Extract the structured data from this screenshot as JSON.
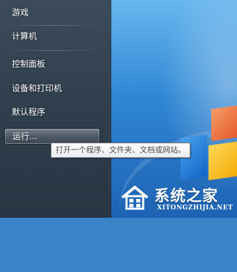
{
  "start_menu": {
    "items": [
      {
        "label": "游戏"
      },
      {
        "label": "计算机"
      },
      {
        "label": "控制面板"
      },
      {
        "label": "设备和打印机"
      },
      {
        "label": "默认程序"
      },
      {
        "label": "运行..."
      }
    ]
  },
  "tooltip": {
    "text": "打开一个程序、文件夹、文档或网站。"
  },
  "watermark": {
    "title": "系统之家",
    "subtitle": "XITONGZHIJIA.NET"
  },
  "colors": {
    "menu_background": "#353f4a",
    "desktop_blue": "#2f87d4",
    "tooltip_border": "#767676"
  }
}
